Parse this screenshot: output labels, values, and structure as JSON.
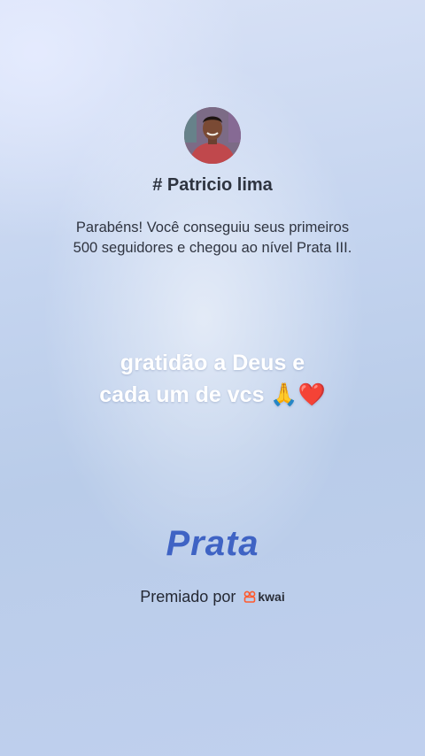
{
  "profile": {
    "username": "# Patricio lima",
    "avatar_icon": "profile-photo"
  },
  "achievement": {
    "message_line1": "Parabéns! Você conseguiu seus primeiros",
    "message_line2": "500 seguidores e chegou ao nível Prata III.",
    "tier": "Prata"
  },
  "user_message": {
    "line1": "gratidão a Deus e",
    "line2": "cada um de vcs 🙏❤️"
  },
  "footer": {
    "awarded_by": "Premiado por",
    "brand": "kwai",
    "brand_color": "#ff5a2e"
  },
  "colors": {
    "tier_text": "#3f63c4",
    "background": "#c4d4ef"
  }
}
